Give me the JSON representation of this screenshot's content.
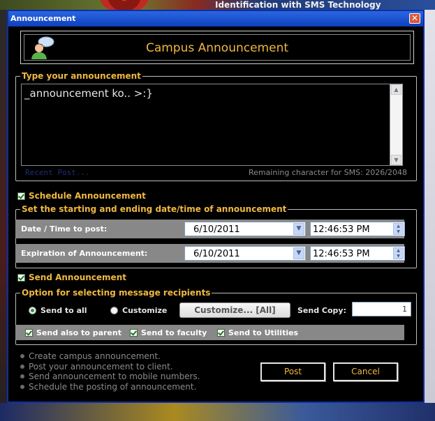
{
  "background": {
    "banner_text": "Identification with SMS Technology"
  },
  "window": {
    "title": "Announcement"
  },
  "header": {
    "title": "Campus Announcement"
  },
  "announcement": {
    "legend": "Type your announcement",
    "text": "_announcement ko.. >:}",
    "recent_post_link": "Recent Post...",
    "remaining": "Remaining character for SMS: 2026/2048"
  },
  "schedule": {
    "checkbox_label": "Schedule Announcement",
    "checked": true,
    "legend": "Set the starting and ending date/time of announcement",
    "post": {
      "label": "Date / Time to post:",
      "date": "6/10/2011",
      "time": "12:46:53 PM"
    },
    "expiration": {
      "label": "Expiration of Announcement:",
      "date": "6/10/2011",
      "time": "12:46:53 PM"
    }
  },
  "send": {
    "checkbox_label": "Send Announcement",
    "checked": true,
    "legend": "Option for selecting message recipients",
    "send_to_all": "Send to all",
    "customize": "Customize",
    "selected_option": "Send to all",
    "customize_button": "Customize... [All]",
    "send_copy_label": "Send Copy:",
    "send_copy_value": "1",
    "also_parent": "Send also to parent",
    "faculty": "Send to faculty",
    "utilities": "Send to Utilities"
  },
  "info": [
    "Create campus announcement.",
    "Post your announcement to client.",
    "Send announcement to mobile numbers.",
    "Schedule the posting of announcement."
  ],
  "buttons": {
    "post": "Post",
    "cancel": "Cancel"
  },
  "colors": {
    "accent": "#f0b840",
    "titlebar": "#0d3fbd",
    "panel_gray": "#888888"
  }
}
